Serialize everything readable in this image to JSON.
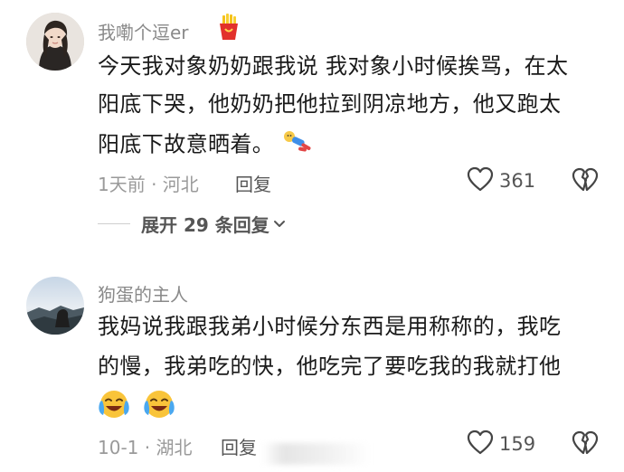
{
  "comments": [
    {
      "username": "我嘞个逗er",
      "badge_icon": "fries-icon",
      "lines": [
        "今天我对象奶奶跟我说 我对象小时候挨骂，在太",
        "阳底下哭，他奶奶把他拉到阴凉地方，他又跑太",
        "阳底下故意晒着。"
      ],
      "emoji_icon": "lying-sunbathing-emoji",
      "meta": "1天前 · 河北",
      "reply_label": "回复",
      "likes": "361",
      "expand_label": "展开 29 条回复"
    },
    {
      "username": "狗蛋的主人",
      "lines": [
        "我妈说我跟我弟小时候分东西是用称称的，我吃",
        "的慢，我弟吃的快，他吃完了要吃我的我就打他"
      ],
      "emoji_icons": [
        "crying-laughing-emoji",
        "crying-laughing-emoji"
      ],
      "meta": "10-1 · 湖北",
      "reply_label": "回复",
      "likes": "159"
    }
  ],
  "colors": {
    "text": "#1a1a1a",
    "meta": "#9a9a9a",
    "username": "#8a8a8a",
    "action": "#555555"
  }
}
